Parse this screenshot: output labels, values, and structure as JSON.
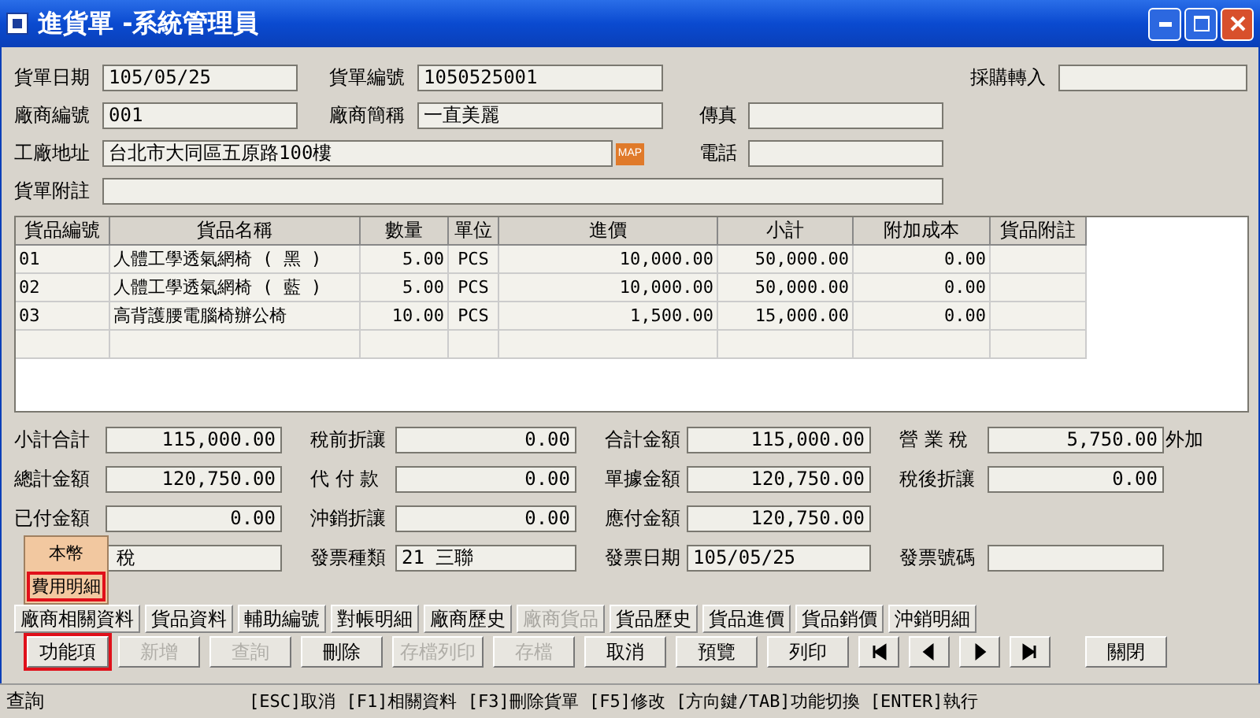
{
  "window": {
    "title": "進貨單 -系統管理員"
  },
  "order_date": {
    "label": "貨單日期",
    "value": "105/05/25"
  },
  "order_no": {
    "label": "貨單編號",
    "value": "1050525001"
  },
  "purchase_import": {
    "label": "採購轉入"
  },
  "vendor_no": {
    "label": "廠商編號",
    "value": "001"
  },
  "vendor_name": {
    "label": "廠商簡稱",
    "value": "一直美麗"
  },
  "fax": {
    "label": "傳真"
  },
  "address": {
    "label": "工廠地址",
    "value": "台北市大同區五原路100樓",
    "map_button": "MAP"
  },
  "phone": {
    "label": "電話"
  },
  "note": {
    "label": "貨單附註"
  },
  "table": {
    "columns": [
      "貨品編號",
      "貨品名稱",
      "數量",
      "單位",
      "進價",
      "小計",
      "附加成本",
      "貨品附註"
    ],
    "rows": [
      [
        "01",
        "人體工學透氣網椅 ( 黑 )",
        "5.00",
        "PCS",
        "10,000.00",
        "50,000.00",
        "0.00",
        ""
      ],
      [
        "02",
        "人體工學透氣網椅 ( 藍 )",
        "5.00",
        "PCS",
        "10,000.00",
        "50,000.00",
        "0.00",
        ""
      ],
      [
        "03",
        "高背護腰電腦椅辦公椅",
        "10.00",
        "PCS",
        "1,500.00",
        "15,000.00",
        "0.00",
        ""
      ],
      [
        "",
        "",
        "",
        "",
        "",
        "",
        "",
        ""
      ]
    ]
  },
  "totals": [
    [
      {
        "label": "小計合計",
        "value": "115,000.00"
      },
      {
        "label": "稅前折讓",
        "value": "0.00"
      },
      {
        "label": "合計金額",
        "value": "115,000.00"
      },
      {
        "label": "營 業 稅",
        "value": "5,750.00",
        "suffix": "外加"
      }
    ],
    [
      {
        "label": "總計金額",
        "value": "120,750.00"
      },
      {
        "label": "代 付 款",
        "value": "0.00"
      },
      {
        "label": "單據金額",
        "value": "120,750.00"
      },
      {
        "label": "稅後折讓",
        "value": "0.00"
      }
    ],
    [
      {
        "label": "已付金額",
        "value": "0.00"
      },
      {
        "label": "沖銷折讓",
        "value": "0.00"
      },
      {
        "label": "應付金額",
        "value": "120,750.00"
      }
    ]
  ],
  "invoice": [
    {
      "value": "稅"
    },
    {
      "label": "發票種類",
      "value": "21 三聯"
    },
    {
      "label": "發票日期",
      "value": "105/05/25"
    },
    {
      "label": "發票號碼"
    }
  ],
  "popup_menu": [
    {
      "label": "本幣",
      "highlighted": false
    },
    {
      "label": "費用明細",
      "highlighted": true
    }
  ],
  "tabs": [
    {
      "label": "廠商相關資料",
      "disabled": false
    },
    {
      "label": "貨品資料",
      "disabled": false
    },
    {
      "label": "輔助編號",
      "disabled": false
    },
    {
      "label": "對帳明細",
      "disabled": false
    },
    {
      "label": "廠商歷史",
      "disabled": false
    },
    {
      "label": "廠商貨品",
      "disabled": true
    },
    {
      "label": "貨品歷史",
      "disabled": false
    },
    {
      "label": "貨品進價",
      "disabled": false
    },
    {
      "label": "貨品銷價",
      "disabled": false
    },
    {
      "label": "沖銷明細",
      "disabled": false
    }
  ],
  "buttons": [
    {
      "kind": "text",
      "label": "功能項",
      "disabled": false,
      "highlighted": true
    },
    {
      "kind": "text",
      "label": "新增",
      "disabled": true,
      "highlighted": false
    },
    {
      "kind": "text",
      "label": "查詢",
      "disabled": true,
      "highlighted": false
    },
    {
      "kind": "text",
      "label": "刪除",
      "disabled": false,
      "highlighted": false
    },
    {
      "kind": "text",
      "label": "存檔列印",
      "disabled": true,
      "highlighted": false
    },
    {
      "kind": "text",
      "label": "存檔",
      "disabled": true,
      "highlighted": false
    },
    {
      "kind": "text",
      "label": "取消",
      "disabled": false,
      "highlighted": false
    },
    {
      "kind": "text",
      "label": "預覽",
      "disabled": false,
      "highlighted": false
    },
    {
      "kind": "text",
      "label": "列印",
      "disabled": false,
      "highlighted": false
    },
    {
      "kind": "first",
      "disabled": false,
      "highlighted": false
    },
    {
      "kind": "prev",
      "disabled": false,
      "highlighted": false
    },
    {
      "kind": "next",
      "disabled": false,
      "highlighted": false
    },
    {
      "kind": "last",
      "disabled": false,
      "highlighted": false
    },
    {
      "kind": "text",
      "label": "關閉",
      "disabled": false,
      "highlighted": false
    }
  ],
  "status_bar": {
    "mode": "查詢",
    "hint": "[ESC]取消 [F1]相關資料 [F3]刪除貨單 [F5]修改 [方向鍵/TAB]功能切換 [ENTER]執行"
  }
}
